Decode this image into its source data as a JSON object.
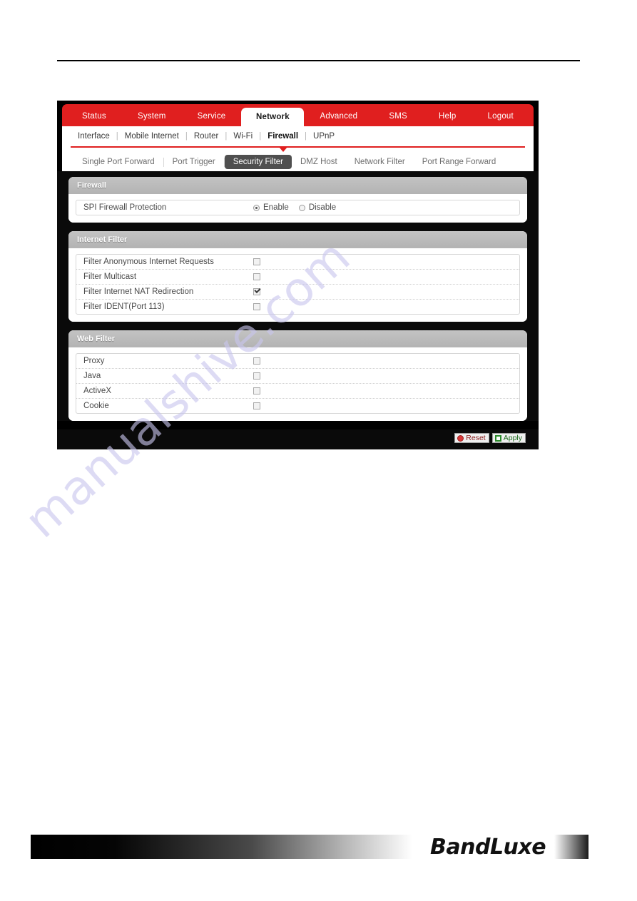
{
  "page": {
    "watermark": "manualshive.com"
  },
  "main_nav": {
    "items": [
      {
        "label": "Status",
        "active": false
      },
      {
        "label": "System",
        "active": false
      },
      {
        "label": "Service",
        "active": false
      },
      {
        "label": "Network",
        "active": true
      },
      {
        "label": "Advanced",
        "active": false
      },
      {
        "label": "SMS",
        "active": false
      },
      {
        "label": "Help",
        "active": false
      },
      {
        "label": "Logout",
        "active": false
      }
    ],
    "bar_color": "#e01f1f"
  },
  "sub_nav": {
    "items": [
      {
        "label": "Interface",
        "active": false
      },
      {
        "label": "Mobile Internet",
        "active": false
      },
      {
        "label": "Router",
        "active": false
      },
      {
        "label": "Wi-Fi",
        "active": false
      },
      {
        "label": "Firewall",
        "active": true
      },
      {
        "label": "UPnP",
        "active": false
      }
    ],
    "separator": "|"
  },
  "tabs": {
    "items": [
      {
        "label": "Single Port Forward",
        "active": false
      },
      {
        "label": "Port Trigger",
        "active": false
      },
      {
        "label": "Security Filter",
        "active": true
      },
      {
        "label": "DMZ Host",
        "active": false
      },
      {
        "label": "Network Filter",
        "active": false
      },
      {
        "label": "Port Range Forward",
        "active": false
      }
    ],
    "active_color": "#4f4f4f"
  },
  "panels": [
    {
      "title": "Firewall",
      "type": "radio",
      "rows": [
        {
          "label": "SPI Firewall Protection",
          "options": [
            {
              "label": "Enable",
              "selected": true
            },
            {
              "label": "Disable",
              "selected": false
            }
          ]
        }
      ]
    },
    {
      "title": "Internet Filter",
      "type": "checkbox",
      "rows": [
        {
          "label": "Filter Anonymous Internet Requests",
          "checked": false
        },
        {
          "label": "Filter Multicast",
          "checked": false
        },
        {
          "label": "Filter Internet NAT Redirection",
          "checked": true
        },
        {
          "label": "Filter IDENT(Port 113)",
          "checked": false
        }
      ]
    },
    {
      "title": "Web Filter",
      "type": "checkbox",
      "rows": [
        {
          "label": "Proxy",
          "checked": false
        },
        {
          "label": "Java",
          "checked": false
        },
        {
          "label": "ActiveX",
          "checked": false
        },
        {
          "label": "Cookie",
          "checked": false
        }
      ]
    }
  ],
  "actions": {
    "reset_label": "Reset",
    "apply_label": "Apply",
    "reset_color": "#8b1d1d",
    "apply_color": "#1d6b1d"
  },
  "footer": {
    "brand": "BandLuxe"
  }
}
